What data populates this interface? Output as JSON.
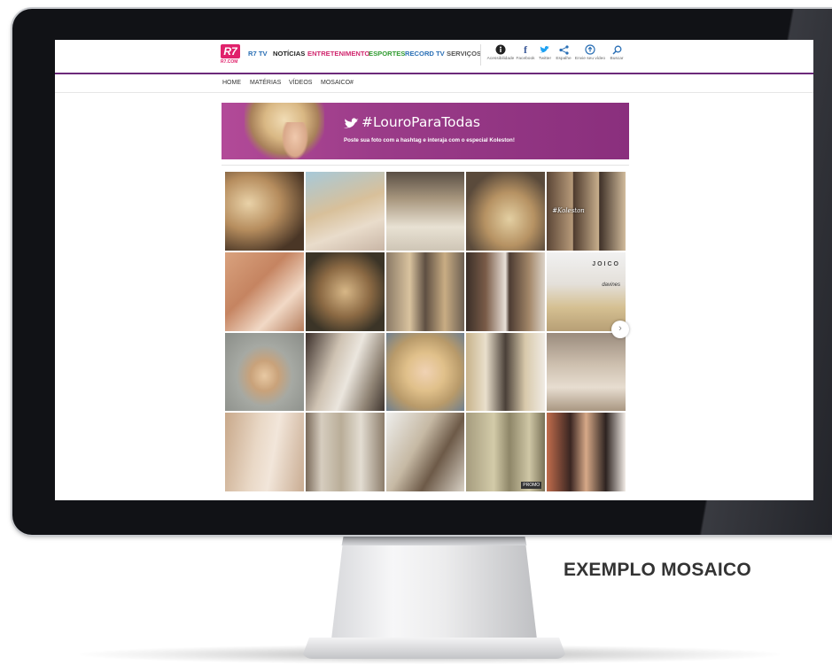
{
  "caption": "EXEMPLO MOSAICO",
  "header": {
    "logo_text": "R7",
    "logo_sub": "R7.COM",
    "nav": [
      {
        "label": "R7 TV",
        "color": "#2a6fb5"
      },
      {
        "label": "NOTÍCIAS",
        "color": "#222222"
      },
      {
        "label": "ENTRETENIMENTO",
        "color": "#d0276e"
      },
      {
        "label": "ESPORTES",
        "color": "#2f9a2f"
      },
      {
        "label": "RECORD TV",
        "color": "#2a6fb5"
      },
      {
        "label": "SERVIÇOS",
        "color": "#555555"
      }
    ],
    "tools": [
      {
        "label": "Acessibilidade",
        "icon": "accessibility-icon"
      },
      {
        "label": "Facebook",
        "icon": "facebook-icon"
      },
      {
        "label": "Twitter",
        "icon": "twitter-icon"
      },
      {
        "label": "Espalhe",
        "icon": "share-icon"
      },
      {
        "label": "Envie seu vídeo",
        "icon": "upload-video-icon"
      },
      {
        "label": "Buscar",
        "icon": "search-icon"
      }
    ]
  },
  "subnav": [
    "HOME",
    "MATÉRIAS",
    "VÍDEOS",
    "MOSAICO#"
  ],
  "banner": {
    "title": "#LouroParaTodas",
    "subtitle": "Poste sua foto com a hashtag e interaja com o especial Koleston!"
  },
  "mosaic": {
    "overlay_text": "#Koleston",
    "brand": "JOICO",
    "brand2": "davines",
    "sign": "PROMO",
    "tiles": [
      {
        "type": "photo"
      },
      {
        "type": "photo"
      },
      {
        "type": "photo"
      },
      {
        "type": "photo"
      },
      {
        "type": "collage"
      },
      {
        "type": "photo"
      },
      {
        "type": "photo"
      },
      {
        "type": "photo"
      },
      {
        "type": "photo"
      },
      {
        "type": "brand"
      },
      {
        "type": "photo"
      },
      {
        "type": "photo"
      },
      {
        "type": "photo"
      },
      {
        "type": "collage"
      },
      {
        "type": "photo"
      },
      {
        "type": "photo"
      },
      {
        "type": "photo"
      },
      {
        "type": "photo"
      },
      {
        "type": "photo"
      },
      {
        "type": "photo"
      }
    ],
    "next_label": "›"
  },
  "colors": {
    "brand_pink": "#e0216b",
    "header_line": "#6c2a7a",
    "banner": "#9a3b88"
  }
}
